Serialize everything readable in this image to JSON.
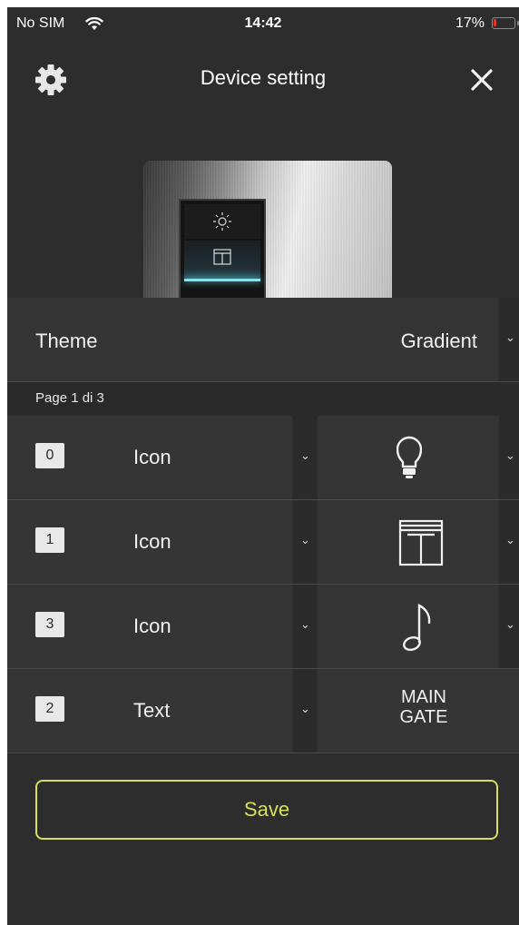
{
  "status_bar": {
    "carrier": "No SIM",
    "time": "14:42",
    "battery_percent": "17%",
    "battery_level": 0.17,
    "battery_color": "#e0342c"
  },
  "header": {
    "title": "Device setting",
    "settings_icon": "gear-icon",
    "close_icon": "close-icon"
  },
  "theme": {
    "label": "Theme",
    "value": "Gradient"
  },
  "page_indicator": "Page 1 di 3",
  "slots": [
    {
      "number": "0",
      "type": "Icon",
      "icon": "lightbulb-icon"
    },
    {
      "number": "1",
      "type": "Icon",
      "icon": "window-blinds-icon"
    },
    {
      "number": "3",
      "type": "Icon",
      "icon": "music-note-icon"
    },
    {
      "number": "2",
      "type": "Text",
      "text_lines": [
        "MAIN",
        "GATE"
      ]
    }
  ],
  "save_label": "Save",
  "colors": {
    "background": "#2d2d2d",
    "row": "#353535",
    "accent": "#d7e05c"
  }
}
